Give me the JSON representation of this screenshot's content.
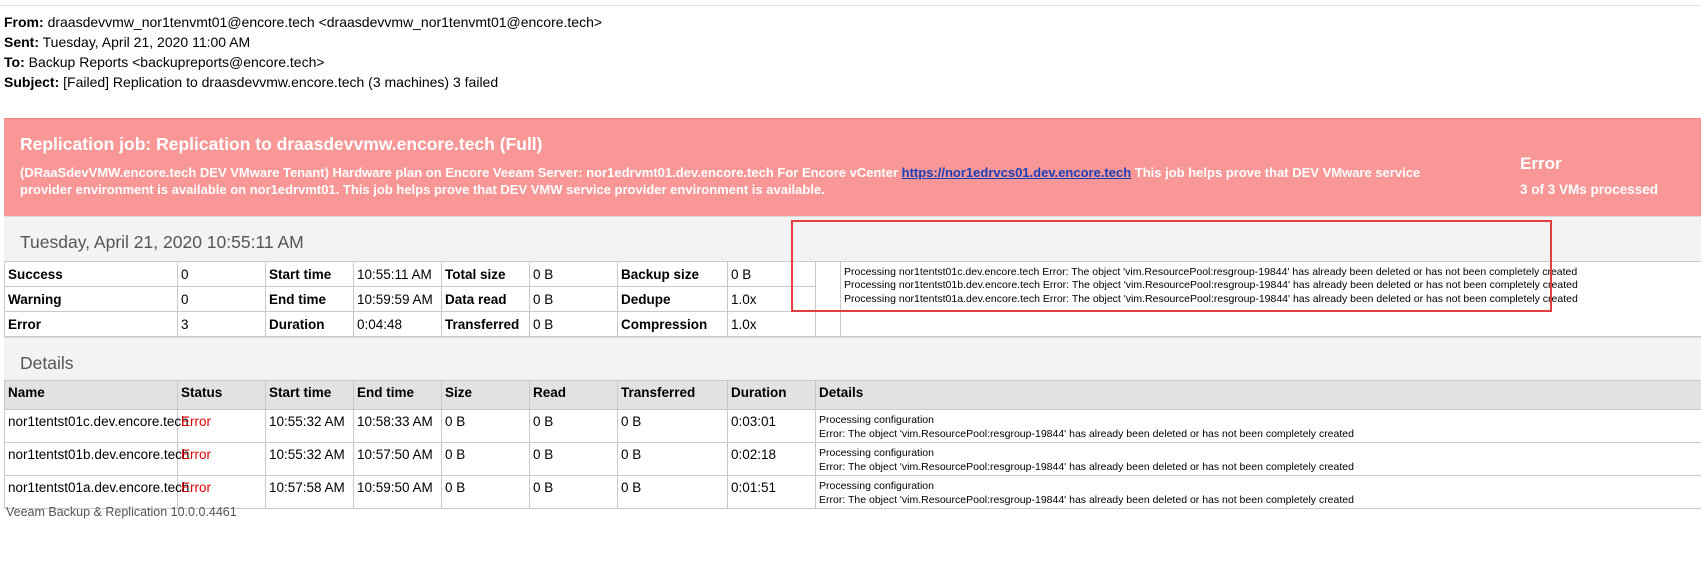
{
  "email": {
    "from_label": "From:",
    "from_value": "draasdevvmw_nor1tenvmt01@encore.tech <draasdevvmw_nor1tenvmt01@encore.tech>",
    "sent_label": "Sent:",
    "sent_value": "Tuesday, April 21, 2020 11:00 AM",
    "to_label": "To:",
    "to_value": "Backup Reports <backupreports@encore.tech>",
    "subject_label": "Subject:",
    "subject_value": "[Failed] Replication to draasdevvmw.encore.tech (3 machines) 3 failed"
  },
  "banner": {
    "title": "Replication job: Replication to draasdevvmw.encore.tech (Full)",
    "desc_before": "(DRaaSdevVMW.encore.tech DEV VMware Tenant) Hardware plan on Encore Veeam Server: nor1edrvmt01.dev.encore.tech For Encore vCenter ",
    "link": "https://nor1edrvcs01.dev.encore.tech",
    "desc_after": " This job helps prove that DEV VMware service provider environment is available on nor1edrvmt01. This job helps prove that DEV VMW service provider environment is available.",
    "status_word": "Error",
    "status_count": "3 of 3 VMs processed",
    "background_color": "#f99797"
  },
  "session": {
    "date": "Tuesday, April 21, 2020 10:55:11 AM",
    "rows": [
      {
        "l1": "Success",
        "v1": "0",
        "l2": "Start time",
        "v2": "10:55:11 AM",
        "l3": "Total size",
        "v3": "0 B",
        "l4": "Backup size",
        "v4": "0 B"
      },
      {
        "l1": "Warning",
        "v1": "0",
        "l2": "End time",
        "v2": "10:59:59 AM",
        "l3": "Data read",
        "v3": "0 B",
        "l4": "Dedupe",
        "v4": "1.0x"
      },
      {
        "l1": "Error",
        "v1": "3",
        "l2": "Duration",
        "v2": "0:04:48",
        "l3": "Transferred",
        "v3": "0 B",
        "l4": "Compression",
        "v4": "1.0x"
      }
    ],
    "error_lines": [
      "Processing nor1tentst01c.dev.encore.tech Error: The object 'vim.ResourcePool:resgroup-19844' has already been deleted or has not been completely created",
      "Processing nor1tentst01b.dev.encore.tech Error: The object 'vim.ResourcePool:resgroup-19844' has already been deleted or has not been completely created",
      "Processing nor1tentst01a.dev.encore.tech Error: The object 'vim.ResourcePool:resgroup-19844' has already been deleted or has not been completely created"
    ]
  },
  "details": {
    "heading": "Details",
    "columns": [
      "Name",
      "Status",
      "Start time",
      "End time",
      "Size",
      "Read",
      "Transferred",
      "Duration",
      "Details"
    ],
    "rows": [
      {
        "name": "nor1tentst01c.dev.encore.tech",
        "status": "Error",
        "start": "10:55:32 AM",
        "end": "10:58:33 AM",
        "size": "0 B",
        "read": "0 B",
        "transferred": "0 B",
        "duration": "0:03:01",
        "d1": "Processing configuration",
        "d2": "Error: The object 'vim.ResourcePool:resgroup-19844' has already been deleted or has not been completely created"
      },
      {
        "name": "nor1tentst01b.dev.encore.tech",
        "status": "Error",
        "start": "10:55:32 AM",
        "end": "10:57:50 AM",
        "size": "0 B",
        "read": "0 B",
        "transferred": "0 B",
        "duration": "0:02:18",
        "d1": "Processing configuration",
        "d2": "Error: The object 'vim.ResourcePool:resgroup-19844' has already been deleted or has not been completely created"
      },
      {
        "name": "nor1tentst01a.dev.encore.tech",
        "status": "Error",
        "start": "10:57:58 AM",
        "end": "10:59:50 AM",
        "size": "0 B",
        "read": "0 B",
        "transferred": "0 B",
        "duration": "0:01:51",
        "d1": "Processing configuration",
        "d2": "Error: The object 'vim.ResourcePool:resgroup-19844' has already been deleted or has not been completely created"
      }
    ]
  },
  "footer": "Veeam Backup & Replication 10.0.0.4461"
}
